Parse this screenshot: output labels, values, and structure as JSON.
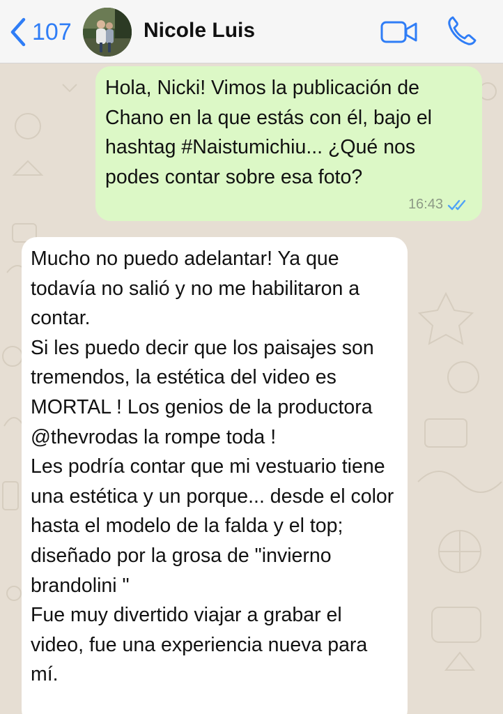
{
  "header": {
    "back_count": "107",
    "contact_name": "Nicole Luis"
  },
  "messages": [
    {
      "direction": "outgoing",
      "text": "Hola, Nicki! Vimos la publicación de Chano en la que estás con él, bajo el hashtag #Naistumichiu... ¿Qué nos podes contar sobre esa foto?",
      "time": "16:43",
      "status": "read"
    },
    {
      "direction": "incoming",
      "text": "Mucho no puedo adelantar! Ya que todavía no salió y no me habilitaron a contar.\nSi les puedo decir que los paisajes son tremendos, la estética del video es MORTAL ! Los genios de la productora @thevrodas la rompe toda !\nLes podría contar que mi vestuario tiene una estética y un porque... desde el color hasta el modelo de la falda y el top; diseñado por la grosa de \"invierno brandolini \"\nFue muy divertido viajar a grabar el video, fue una experiencia nueva para mí."
    }
  ],
  "colors": {
    "accent": "#2f7df6",
    "outgoing_bubble": "#dcf8c6",
    "incoming_bubble": "#ffffff",
    "read_ticks": "#4fa3f7",
    "chat_background": "#e6ded3"
  },
  "icons": {
    "back": "chevron-left-icon",
    "video": "video-camera-icon",
    "call": "phone-icon"
  }
}
